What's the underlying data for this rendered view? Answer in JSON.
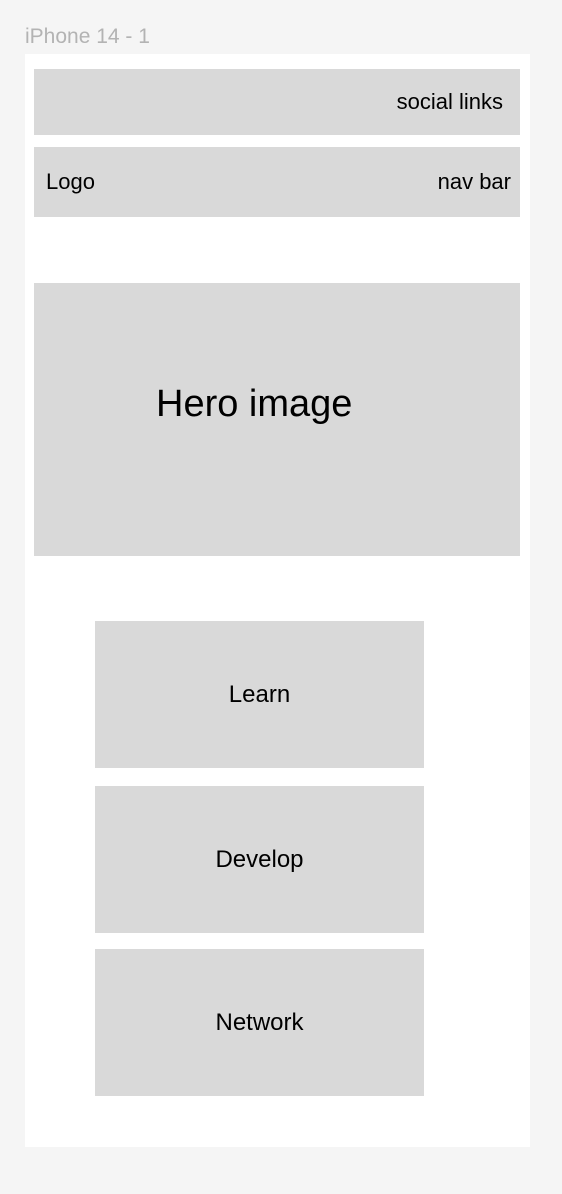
{
  "frame": {
    "label": "iPhone 14 - 1"
  },
  "header": {
    "social_links": "social links"
  },
  "nav": {
    "logo": "Logo",
    "nav_bar": "nav bar"
  },
  "hero": {
    "label": "Hero image"
  },
  "cards": [
    {
      "label": "Learn"
    },
    {
      "label": "Develop"
    },
    {
      "label": "Network"
    }
  ],
  "colors": {
    "canvas": "#f5f5f5",
    "frame": "#ffffff",
    "placeholder": "#d9d9d9",
    "frame_label": "#b3b3b3"
  }
}
